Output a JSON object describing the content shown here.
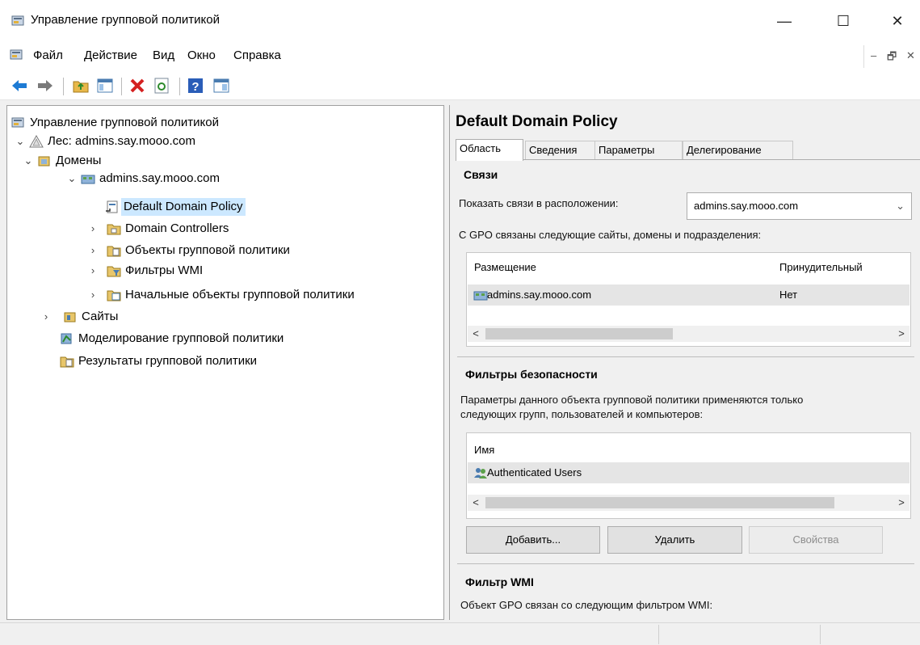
{
  "window": {
    "title": "Управление групповой политикой",
    "minimize_glyph": "—",
    "maximize_glyph": "☐",
    "close_glyph": "✕"
  },
  "menu": {
    "items": [
      "Файл",
      "Действие",
      "Вид",
      "Окно",
      "Справка"
    ],
    "mdi_minimize": "–",
    "mdi_restore": "🗗",
    "mdi_close": "✕"
  },
  "toolbar": {
    "icons": [
      "back-arrow-icon",
      "forward-arrow-icon",
      "up-folder-icon",
      "show-hide-tree-icon",
      "delete-icon",
      "refresh-icon",
      "help-icon",
      "properties-pane-icon"
    ]
  },
  "tree": {
    "root": "Управление групповой политикой",
    "forest": "Лес: admins.say.mooo.com",
    "domains": "Домены",
    "domain": "admins.say.mooo.com",
    "default_policy": "Default Domain Policy",
    "domain_controllers": "Domain Controllers",
    "gpo_objects": "Объекты групповой политики",
    "wmi_filters": "Фильтры WMI",
    "starter_gpos": "Начальные объекты групповой политики",
    "sites": "Сайты",
    "modeling": "Моделирование групповой политики",
    "results": "Результаты групповой политики",
    "expanded_glyph": "⌄",
    "collapsed_glyph": "›"
  },
  "details": {
    "title": "Default Domain Policy",
    "tabs": [
      "Область",
      "Сведения",
      "Параметры",
      "Делегирование"
    ],
    "links": {
      "section_title": "Связи",
      "show_links_label": "Показать связи в расположении:",
      "location_value": "admins.say.mooo.com",
      "description": "С GPO связаны следующие сайты, домены и подразделения:",
      "columns": [
        "Размещение",
        "Принудительный"
      ],
      "rows": [
        {
          "location": "admins.say.mooo.com",
          "enforced": "Нет"
        }
      ]
    },
    "security": {
      "section_title": "Фильтры безопасности",
      "description_line1": "Параметры данного объекта групповой политики применяются только",
      "description_line2": "следующих групп, пользователей и компьютеров:",
      "column": "Имя",
      "rows": [
        "Authenticated Users"
      ],
      "add_button": "Добавить...",
      "remove_button": "Удалить",
      "properties_button": "Свойства"
    },
    "wmi": {
      "section_title": "Фильтр WMI",
      "description": "Объект GPO связан со следующим фильтром WMI:"
    }
  },
  "scroll": {
    "left": "<",
    "right": ">"
  },
  "colors": {
    "selection": "#cce8ff",
    "row_highlight": "#e5e5e5",
    "back_arrow": "#1e7bd4",
    "delete_red": "#d42020"
  }
}
